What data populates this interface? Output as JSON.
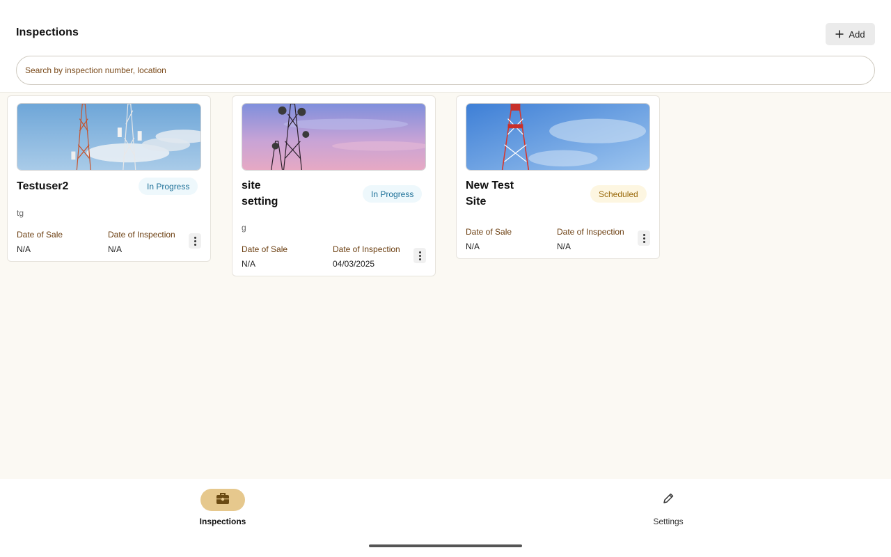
{
  "header": {
    "title": "Inspections",
    "add_label": "Add",
    "search_placeholder": "Search by inspection number, location"
  },
  "cards": [
    {
      "title": "Testuser2",
      "status": "In Progress",
      "description": "tg",
      "date_of_sale_label": "Date of Sale",
      "date_of_sale": "N/A",
      "date_of_inspection_label": "Date of Inspection",
      "date_of_inspection": "N/A",
      "image_icon": "cell-tower-image"
    },
    {
      "title": "site setting",
      "status": "In Progress",
      "description": "g",
      "date_of_sale_label": "Date of Sale",
      "date_of_sale": "N/A",
      "date_of_inspection_label": "Date of Inspection",
      "date_of_inspection": "04/03/2025",
      "image_icon": "cell-tower-sunset-image"
    },
    {
      "title": "New Test Site",
      "status": "Scheduled",
      "description": "",
      "date_of_sale_label": "Date of Sale",
      "date_of_sale": "N/A",
      "date_of_inspection_label": "Date of Inspection",
      "date_of_inspection": "N/A",
      "image_icon": "radio-tower-image"
    }
  ],
  "bottom_nav": {
    "items": [
      {
        "label": "Inspections",
        "icon": "briefcase-icon",
        "active": true
      },
      {
        "label": "Settings",
        "icon": "pencil-icon",
        "active": false
      }
    ]
  },
  "colors": {
    "accent": "#e6c88d",
    "background": "#fbf9f3",
    "in_progress_text": "#1b6f97",
    "in_progress_bg": "#eef8fc",
    "scheduled_text": "#9a6a0c",
    "scheduled_bg": "#fdf6e1",
    "label_brown": "#6b3e10"
  }
}
